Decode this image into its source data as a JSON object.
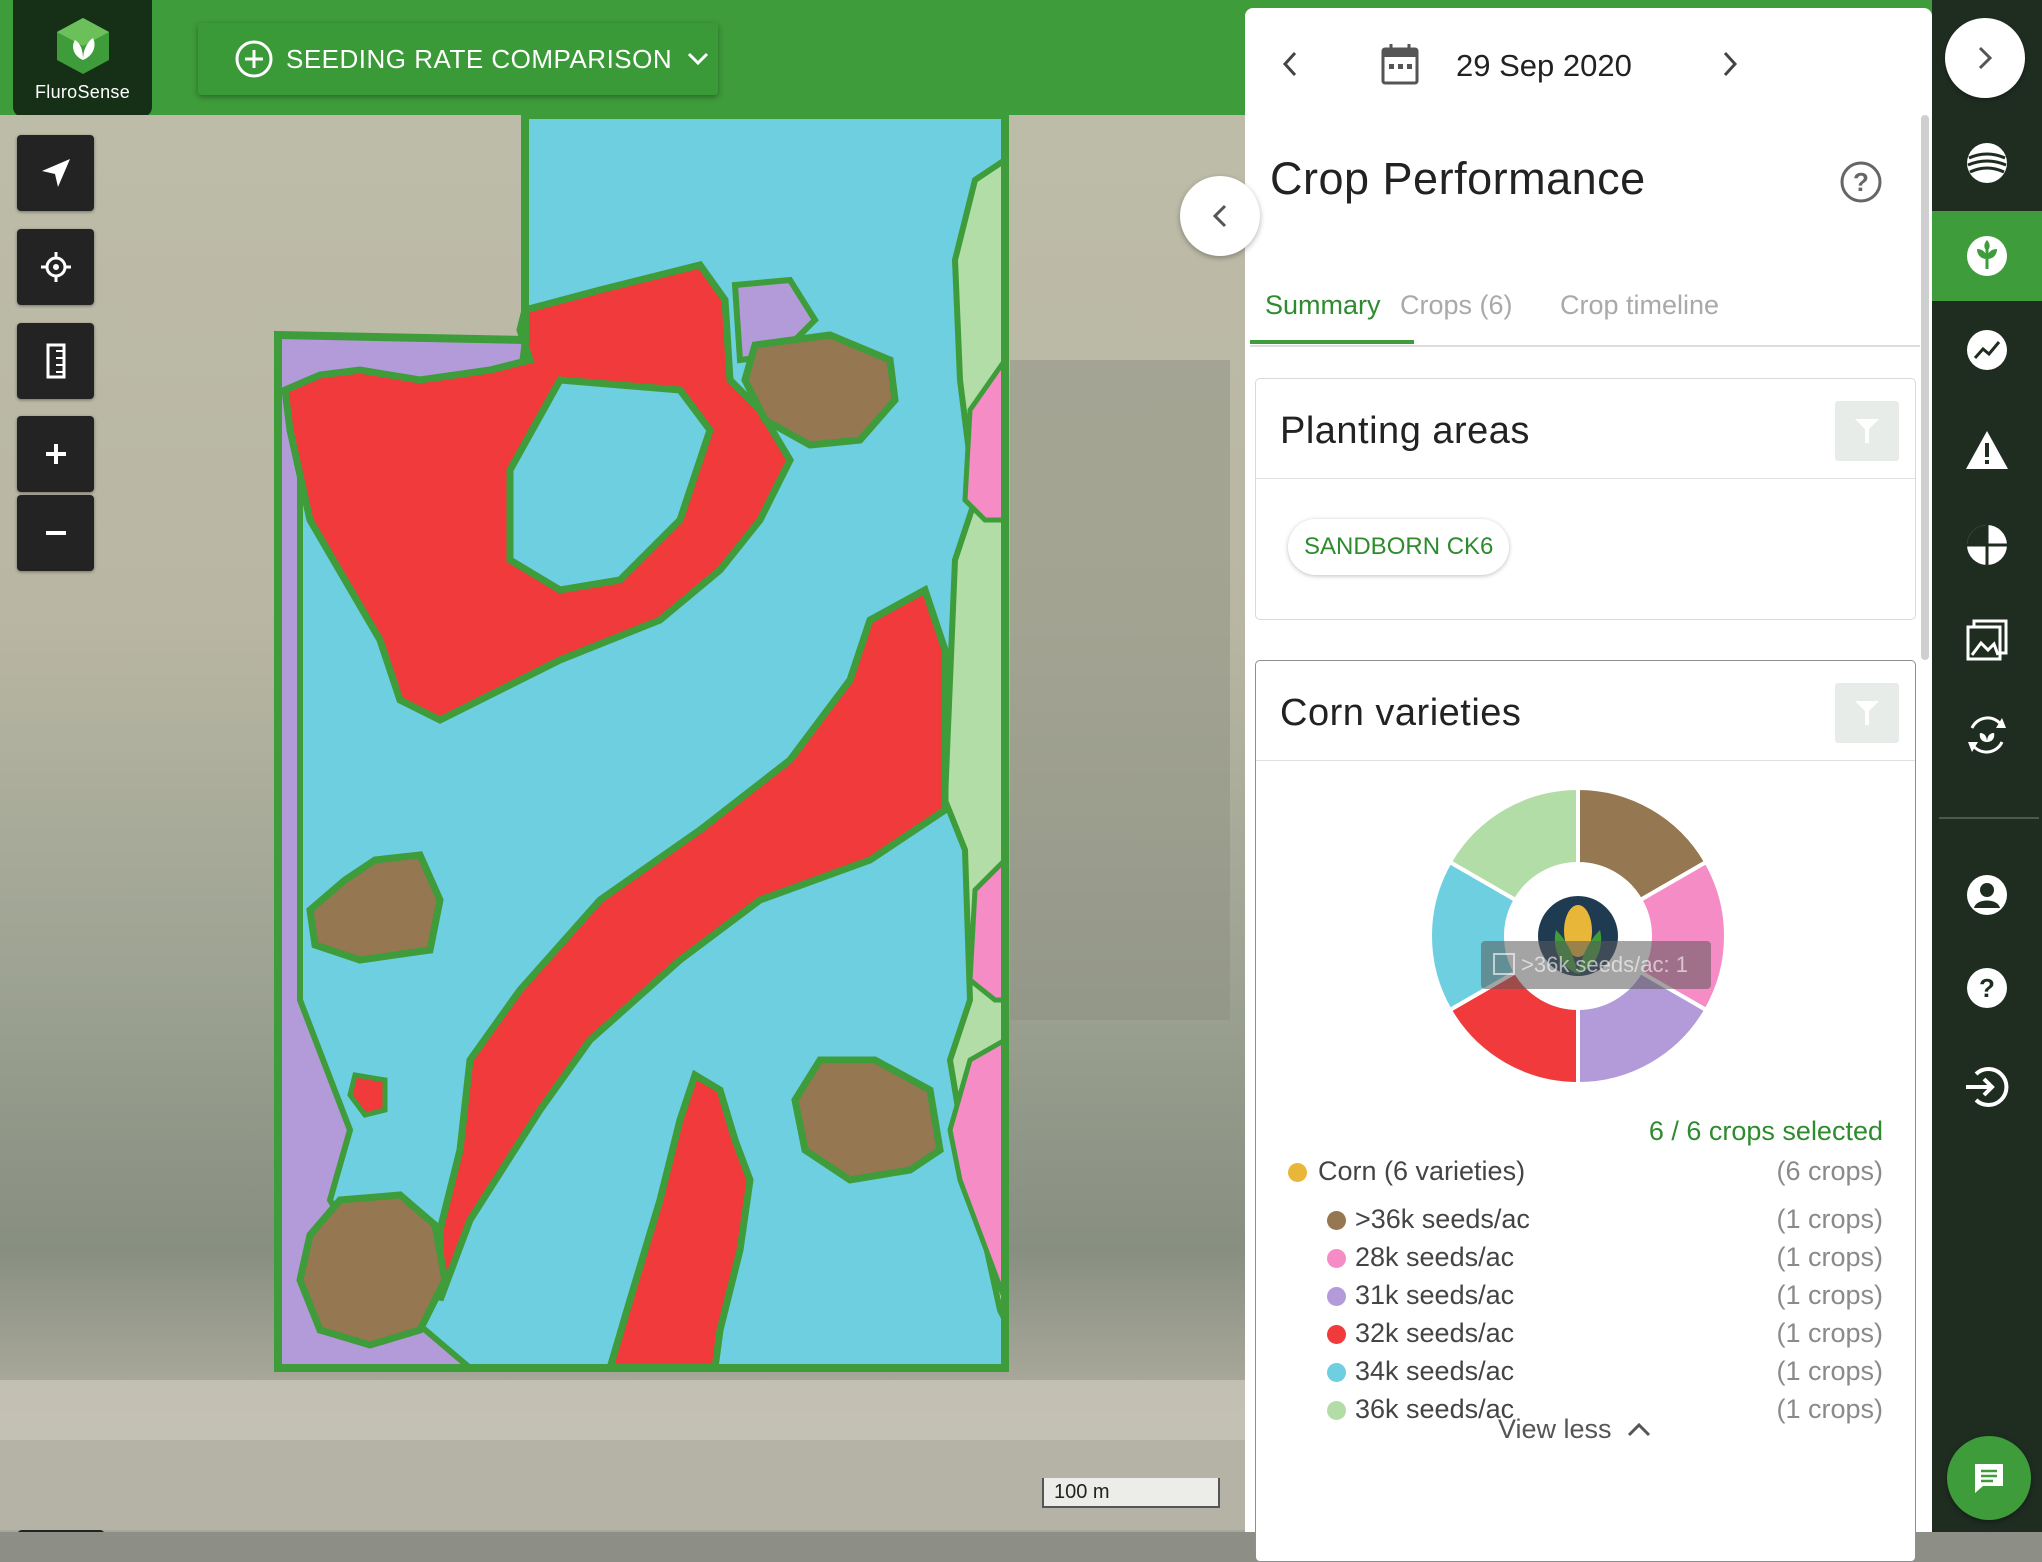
{
  "app": {
    "brand": "FluroSense",
    "mode_button_label": "SEEDING RATE COMPARISON"
  },
  "map": {
    "scale_label": "100 m",
    "zone_colors": {
      ">36k": "#957751",
      "28k": "#f58cc6",
      "31k": "#b39ad9",
      "32k": "#f13a3b",
      "34k": "#6dcfdf",
      "36k": "#b3dda6",
      "boundary": "#3e9c3a"
    }
  },
  "panel": {
    "date": "29 Sep 2020",
    "title": "Crop Performance",
    "tabs": [
      {
        "label": "Summary",
        "active": true
      },
      {
        "label": "Crops (6)",
        "active": false
      },
      {
        "label": "Crop timeline",
        "active": false
      }
    ],
    "planting_areas": {
      "title": "Planting areas",
      "chips": [
        "SANDBORN CK6"
      ]
    },
    "corn_varieties": {
      "title": "Corn varieties",
      "tooltip": ">36k seeds/ac: 1",
      "selected_text": "6 / 6 crops selected",
      "group": {
        "label": "Corn (6 varieties)",
        "count": "(6 crops)",
        "color": "#e8b73a"
      },
      "varieties": [
        {
          "label": ">36k seeds/ac",
          "count": "(1 crops)",
          "color": "#957751"
        },
        {
          "label": "28k seeds/ac",
          "count": "(1 crops)",
          "color": "#f58cc6"
        },
        {
          "label": "31k seeds/ac",
          "count": "(1 crops)",
          "color": "#b39ad9"
        },
        {
          "label": "32k seeds/ac",
          "count": "(1 crops)",
          "color": "#f13a3b"
        },
        {
          "label": "34k seeds/ac",
          "count": "(1 crops)",
          "color": "#6dcfdf"
        },
        {
          "label": "36k seeds/ac",
          "count": "(1 crops)",
          "color": "#b3dda6"
        }
      ],
      "view_less": "View less"
    }
  },
  "rail": {
    "icons": [
      "layers-icon",
      "crop-icon",
      "trend-icon",
      "alert-icon",
      "zones-icon",
      "gallery-icon",
      "cycle-icon",
      "account-icon",
      "help-icon",
      "logout-icon"
    ],
    "active": "crop-icon"
  }
}
